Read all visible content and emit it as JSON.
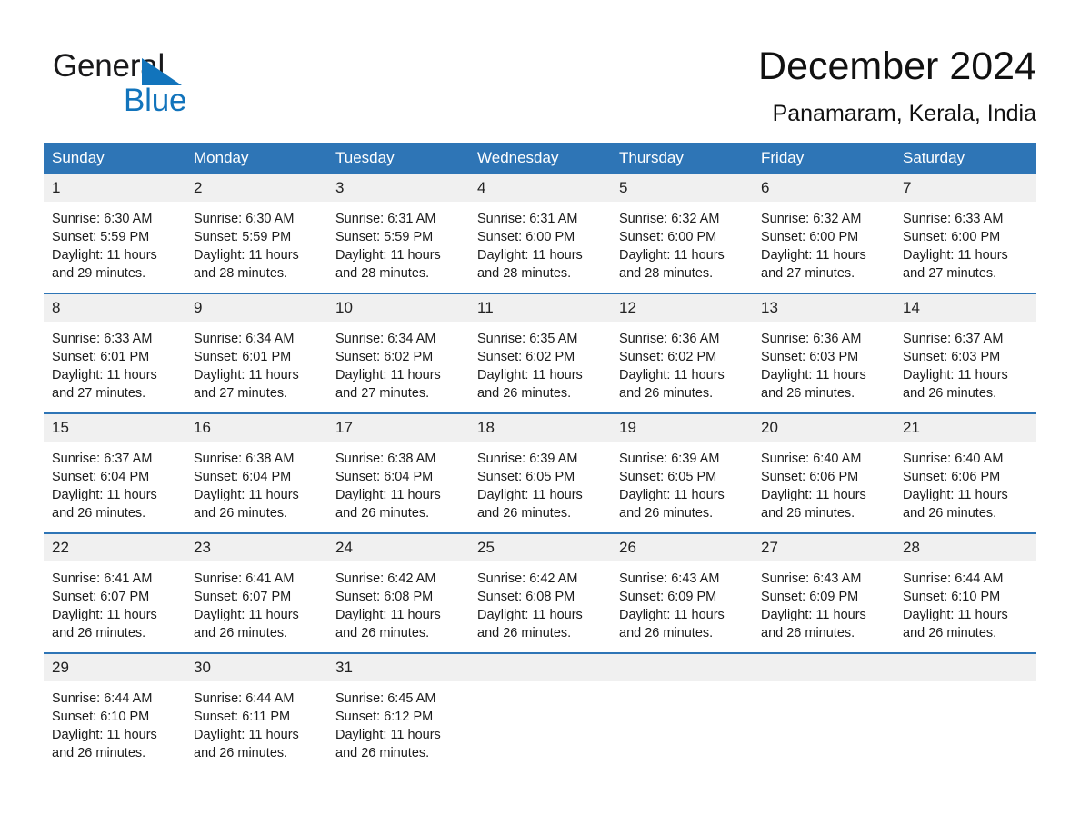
{
  "brand": {
    "name_part1": "General",
    "name_part2": "Blue",
    "logo_icon": "triangle-flag-icon",
    "accent_color": "#1274bc"
  },
  "header": {
    "title": "December 2024",
    "location": "Panamaram, Kerala, India"
  },
  "theme": {
    "header_blue": "#2e75b6",
    "daynum_band": "#f0f0f0",
    "text": "#1b1b1b"
  },
  "calendar": {
    "weekday_headers": [
      "Sunday",
      "Monday",
      "Tuesday",
      "Wednesday",
      "Thursday",
      "Friday",
      "Saturday"
    ],
    "weeks": [
      [
        {
          "day": "1",
          "sunrise": "Sunrise: 6:30 AM",
          "sunset": "Sunset: 5:59 PM",
          "daylight_line1": "Daylight: 11 hours",
          "daylight_line2": "and 29 minutes."
        },
        {
          "day": "2",
          "sunrise": "Sunrise: 6:30 AM",
          "sunset": "Sunset: 5:59 PM",
          "daylight_line1": "Daylight: 11 hours",
          "daylight_line2": "and 28 minutes."
        },
        {
          "day": "3",
          "sunrise": "Sunrise: 6:31 AM",
          "sunset": "Sunset: 5:59 PM",
          "daylight_line1": "Daylight: 11 hours",
          "daylight_line2": "and 28 minutes."
        },
        {
          "day": "4",
          "sunrise": "Sunrise: 6:31 AM",
          "sunset": "Sunset: 6:00 PM",
          "daylight_line1": "Daylight: 11 hours",
          "daylight_line2": "and 28 minutes."
        },
        {
          "day": "5",
          "sunrise": "Sunrise: 6:32 AM",
          "sunset": "Sunset: 6:00 PM",
          "daylight_line1": "Daylight: 11 hours",
          "daylight_line2": "and 28 minutes."
        },
        {
          "day": "6",
          "sunrise": "Sunrise: 6:32 AM",
          "sunset": "Sunset: 6:00 PM",
          "daylight_line1": "Daylight: 11 hours",
          "daylight_line2": "and 27 minutes."
        },
        {
          "day": "7",
          "sunrise": "Sunrise: 6:33 AM",
          "sunset": "Sunset: 6:00 PM",
          "daylight_line1": "Daylight: 11 hours",
          "daylight_line2": "and 27 minutes."
        }
      ],
      [
        {
          "day": "8",
          "sunrise": "Sunrise: 6:33 AM",
          "sunset": "Sunset: 6:01 PM",
          "daylight_line1": "Daylight: 11 hours",
          "daylight_line2": "and 27 minutes."
        },
        {
          "day": "9",
          "sunrise": "Sunrise: 6:34 AM",
          "sunset": "Sunset: 6:01 PM",
          "daylight_line1": "Daylight: 11 hours",
          "daylight_line2": "and 27 minutes."
        },
        {
          "day": "10",
          "sunrise": "Sunrise: 6:34 AM",
          "sunset": "Sunset: 6:02 PM",
          "daylight_line1": "Daylight: 11 hours",
          "daylight_line2": "and 27 minutes."
        },
        {
          "day": "11",
          "sunrise": "Sunrise: 6:35 AM",
          "sunset": "Sunset: 6:02 PM",
          "daylight_line1": "Daylight: 11 hours",
          "daylight_line2": "and 26 minutes."
        },
        {
          "day": "12",
          "sunrise": "Sunrise: 6:36 AM",
          "sunset": "Sunset: 6:02 PM",
          "daylight_line1": "Daylight: 11 hours",
          "daylight_line2": "and 26 minutes."
        },
        {
          "day": "13",
          "sunrise": "Sunrise: 6:36 AM",
          "sunset": "Sunset: 6:03 PM",
          "daylight_line1": "Daylight: 11 hours",
          "daylight_line2": "and 26 minutes."
        },
        {
          "day": "14",
          "sunrise": "Sunrise: 6:37 AM",
          "sunset": "Sunset: 6:03 PM",
          "daylight_line1": "Daylight: 11 hours",
          "daylight_line2": "and 26 minutes."
        }
      ],
      [
        {
          "day": "15",
          "sunrise": "Sunrise: 6:37 AM",
          "sunset": "Sunset: 6:04 PM",
          "daylight_line1": "Daylight: 11 hours",
          "daylight_line2": "and 26 minutes."
        },
        {
          "day": "16",
          "sunrise": "Sunrise: 6:38 AM",
          "sunset": "Sunset: 6:04 PM",
          "daylight_line1": "Daylight: 11 hours",
          "daylight_line2": "and 26 minutes."
        },
        {
          "day": "17",
          "sunrise": "Sunrise: 6:38 AM",
          "sunset": "Sunset: 6:04 PM",
          "daylight_line1": "Daylight: 11 hours",
          "daylight_line2": "and 26 minutes."
        },
        {
          "day": "18",
          "sunrise": "Sunrise: 6:39 AM",
          "sunset": "Sunset: 6:05 PM",
          "daylight_line1": "Daylight: 11 hours",
          "daylight_line2": "and 26 minutes."
        },
        {
          "day": "19",
          "sunrise": "Sunrise: 6:39 AM",
          "sunset": "Sunset: 6:05 PM",
          "daylight_line1": "Daylight: 11 hours",
          "daylight_line2": "and 26 minutes."
        },
        {
          "day": "20",
          "sunrise": "Sunrise: 6:40 AM",
          "sunset": "Sunset: 6:06 PM",
          "daylight_line1": "Daylight: 11 hours",
          "daylight_line2": "and 26 minutes."
        },
        {
          "day": "21",
          "sunrise": "Sunrise: 6:40 AM",
          "sunset": "Sunset: 6:06 PM",
          "daylight_line1": "Daylight: 11 hours",
          "daylight_line2": "and 26 minutes."
        }
      ],
      [
        {
          "day": "22",
          "sunrise": "Sunrise: 6:41 AM",
          "sunset": "Sunset: 6:07 PM",
          "daylight_line1": "Daylight: 11 hours",
          "daylight_line2": "and 26 minutes."
        },
        {
          "day": "23",
          "sunrise": "Sunrise: 6:41 AM",
          "sunset": "Sunset: 6:07 PM",
          "daylight_line1": "Daylight: 11 hours",
          "daylight_line2": "and 26 minutes."
        },
        {
          "day": "24",
          "sunrise": "Sunrise: 6:42 AM",
          "sunset": "Sunset: 6:08 PM",
          "daylight_line1": "Daylight: 11 hours",
          "daylight_line2": "and 26 minutes."
        },
        {
          "day": "25",
          "sunrise": "Sunrise: 6:42 AM",
          "sunset": "Sunset: 6:08 PM",
          "daylight_line1": "Daylight: 11 hours",
          "daylight_line2": "and 26 minutes."
        },
        {
          "day": "26",
          "sunrise": "Sunrise: 6:43 AM",
          "sunset": "Sunset: 6:09 PM",
          "daylight_line1": "Daylight: 11 hours",
          "daylight_line2": "and 26 minutes."
        },
        {
          "day": "27",
          "sunrise": "Sunrise: 6:43 AM",
          "sunset": "Sunset: 6:09 PM",
          "daylight_line1": "Daylight: 11 hours",
          "daylight_line2": "and 26 minutes."
        },
        {
          "day": "28",
          "sunrise": "Sunrise: 6:44 AM",
          "sunset": "Sunset: 6:10 PM",
          "daylight_line1": "Daylight: 11 hours",
          "daylight_line2": "and 26 minutes."
        }
      ],
      [
        {
          "day": "29",
          "sunrise": "Sunrise: 6:44 AM",
          "sunset": "Sunset: 6:10 PM",
          "daylight_line1": "Daylight: 11 hours",
          "daylight_line2": "and 26 minutes."
        },
        {
          "day": "30",
          "sunrise": "Sunrise: 6:44 AM",
          "sunset": "Sunset: 6:11 PM",
          "daylight_line1": "Daylight: 11 hours",
          "daylight_line2": "and 26 minutes."
        },
        {
          "day": "31",
          "sunrise": "Sunrise: 6:45 AM",
          "sunset": "Sunset: 6:12 PM",
          "daylight_line1": "Daylight: 11 hours",
          "daylight_line2": "and 26 minutes."
        },
        {
          "day": "",
          "sunrise": "",
          "sunset": "",
          "daylight_line1": "",
          "daylight_line2": ""
        },
        {
          "day": "",
          "sunrise": "",
          "sunset": "",
          "daylight_line1": "",
          "daylight_line2": ""
        },
        {
          "day": "",
          "sunrise": "",
          "sunset": "",
          "daylight_line1": "",
          "daylight_line2": ""
        },
        {
          "day": "",
          "sunrise": "",
          "sunset": "",
          "daylight_line1": "",
          "daylight_line2": ""
        }
      ]
    ]
  }
}
